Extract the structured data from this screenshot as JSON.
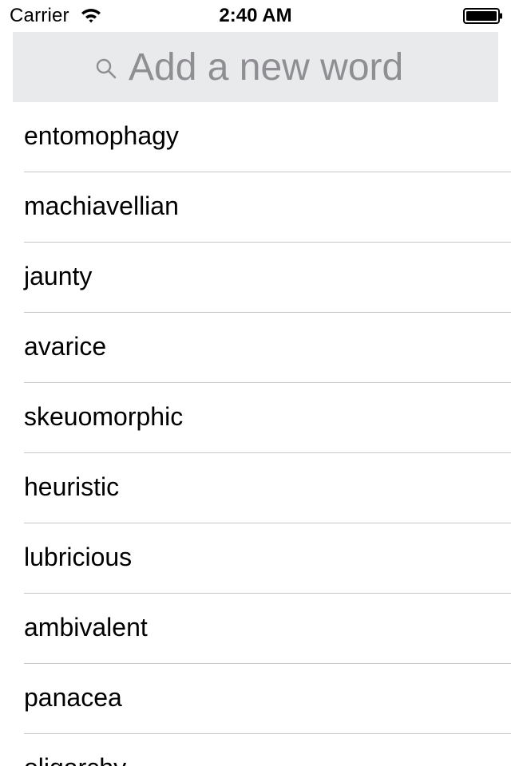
{
  "status_bar": {
    "carrier": "Carrier",
    "time": "2:40 AM",
    "icons": [
      "wifi-icon",
      "battery-icon"
    ]
  },
  "search": {
    "placeholder": "Add a new word",
    "value": "",
    "icon": "search-icon",
    "background_color": "#e9eaec",
    "placeholder_color": "#8e8e93"
  },
  "words": [
    "entomophagy",
    "machiavellian",
    "jaunty",
    "avarice",
    "skeuomorphic",
    "heuristic",
    "lubricious",
    "ambivalent",
    "panacea",
    "oligarchy"
  ],
  "colors": {
    "separator": "#c8c7cc",
    "text": "#000000",
    "background": "#ffffff"
  }
}
